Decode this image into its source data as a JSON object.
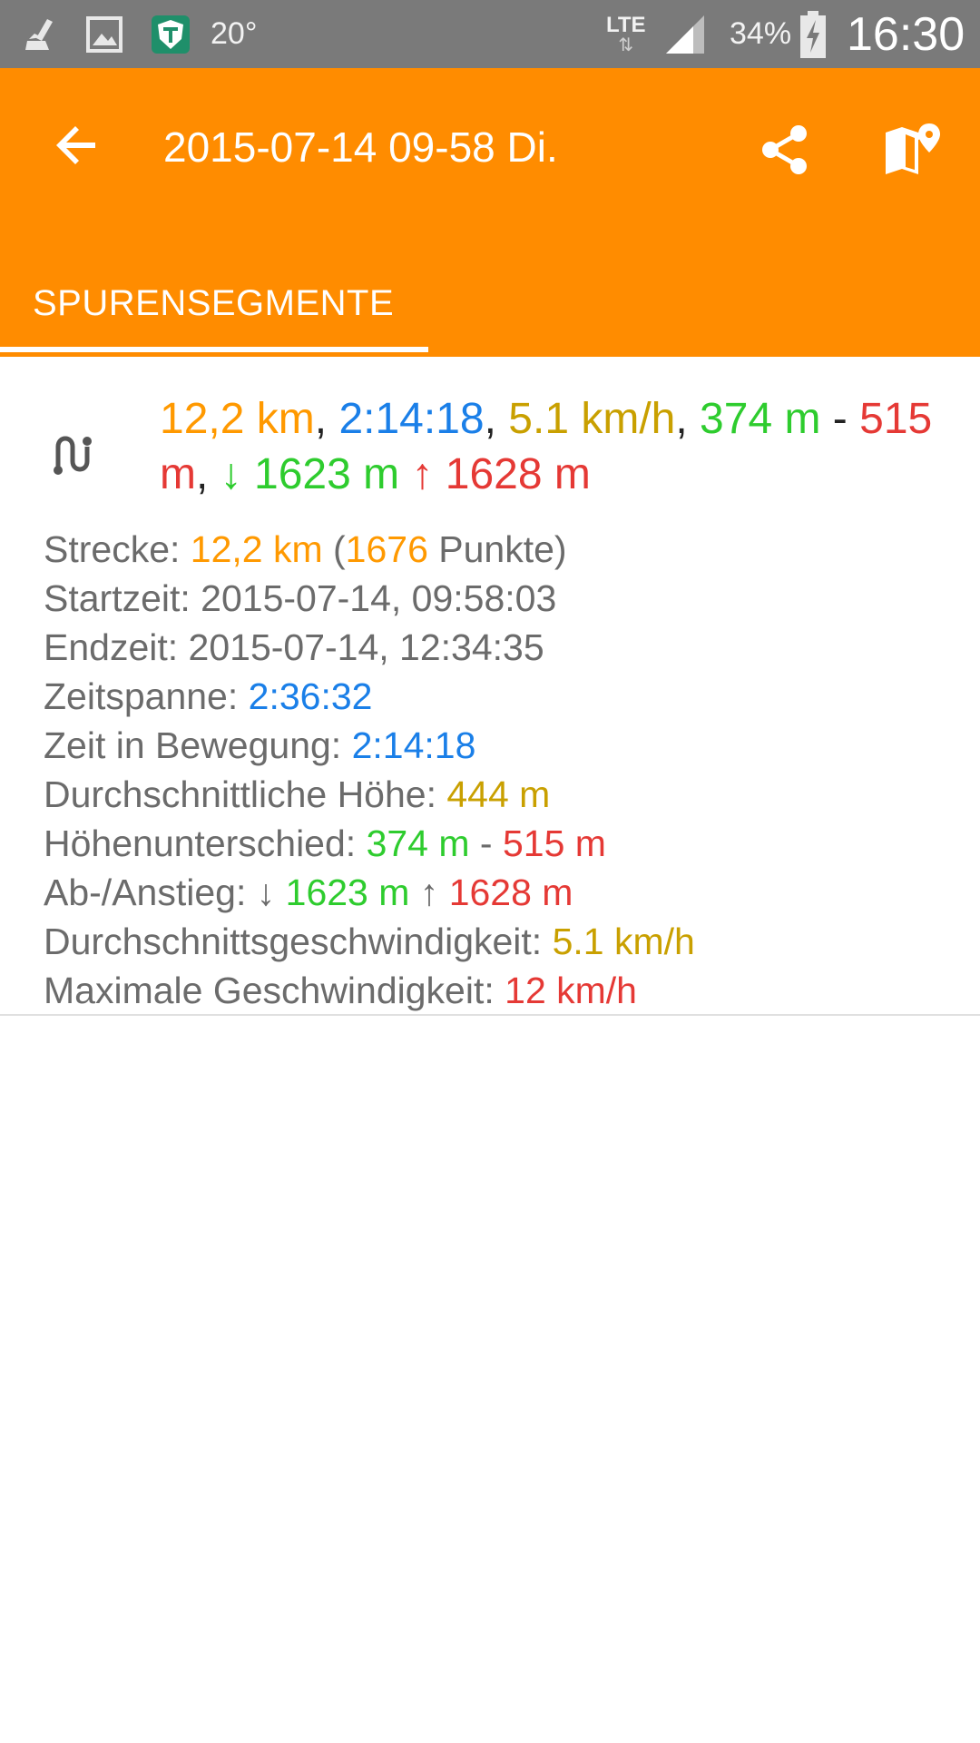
{
  "status_bar": {
    "temperature": "20°",
    "network": "LTE",
    "battery": "34%",
    "time": "16:30",
    "icons": [
      "cleaner-icon",
      "gallery-icon",
      "shield-app-icon",
      "signal-icon",
      "battery-charging-icon"
    ]
  },
  "app_bar": {
    "title": "2015-07-14 09-58 Di.",
    "actions": [
      "back-arrow-icon",
      "share-icon",
      "map-marker-icon"
    ],
    "color": "#ff8c00"
  },
  "tabs": [
    {
      "label": "SPURENSEGMENTE",
      "selected": true
    }
  ],
  "segment": {
    "icon": "route-icon",
    "summary": {
      "distance": "12,2 km",
      "sep1": ",",
      "moving_time": "2:14:18",
      "sep2": ",",
      "avg_speed": "5.1 km/h",
      "sep3": ",",
      "min_alt": "374 m",
      "dash": "-",
      "max_alt": "515 m",
      "sep4": ",",
      "descent": "↓ 1623 m",
      "ascent": "↑ 1628 m"
    },
    "details": {
      "distance_label": "Strecke: ",
      "distance_value": "12,2 km",
      "points_open": " (",
      "points_value": "1676",
      "points_close": " Punkte)",
      "start_label": "Startzeit: ",
      "start_value": "2015-07-14, 09:58:03",
      "end_label": "Endzeit: ",
      "end_value": "2015-07-14, 12:34:35",
      "span_label": "Zeitspanne: ",
      "span_value": "2:36:32",
      "moving_label": "Zeit in Bewegung: ",
      "moving_value": "2:14:18",
      "avg_alt_label": "Durchschnittliche Höhe: ",
      "avg_alt_value": "444 m",
      "alt_diff_label": "Höhenunterschied: ",
      "alt_diff_min": "374 m",
      "alt_diff_dash": " - ",
      "alt_diff_max": "515 m",
      "climb_label": "Ab-/Anstieg: ",
      "climb_down_arrow": "↓ ",
      "climb_down": "1623 m",
      "climb_up_arrow": " ↑ ",
      "climb_up": "1628 m",
      "avg_speed_label": "Durchschnittsgeschwindigkeit: ",
      "avg_speed_value": "5.1 km/h",
      "max_speed_label": "Maximale Geschwindigkeit: ",
      "max_speed_value": "12 km/h"
    }
  },
  "colors": {
    "distance": "#ff9900",
    "time": "#1a7fe8",
    "speed": "#c9a000",
    "low": "#2ecc2e",
    "high": "#e53935"
  }
}
